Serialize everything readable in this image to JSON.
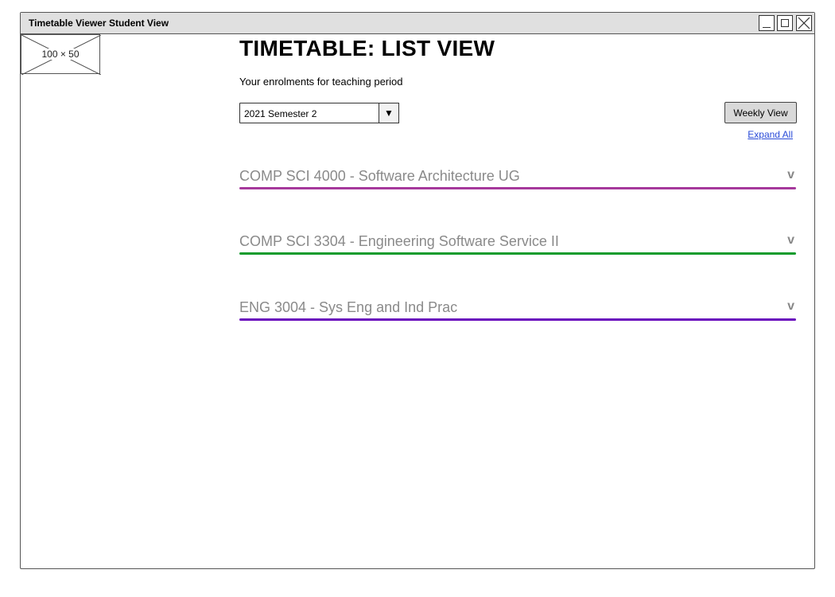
{
  "window": {
    "title": "Timetable Viewer Student View"
  },
  "logo": {
    "placeholder_text": "100 × 50"
  },
  "header": {
    "title": "TIMETABLE: LIST VIEW",
    "subtitle": "Your enrolments for teaching period"
  },
  "period_select": {
    "selected": "2021 Semester 2",
    "arrow": "▼"
  },
  "actions": {
    "weekly_view_label": "Weekly View",
    "expand_all_label": "Expand All"
  },
  "courses": [
    {
      "name": "COMP SCI 4000 - Software Architecture UG",
      "chevron": "v",
      "color": "#a6399c"
    },
    {
      "name": "COMP SCI 3304 - Engineering Software Service II",
      "chevron": "v",
      "color": "#0f9b2c"
    },
    {
      "name": "ENG 3004 - Sys Eng and Ind Prac",
      "chevron": "v",
      "color": "#6a0dbd"
    }
  ]
}
